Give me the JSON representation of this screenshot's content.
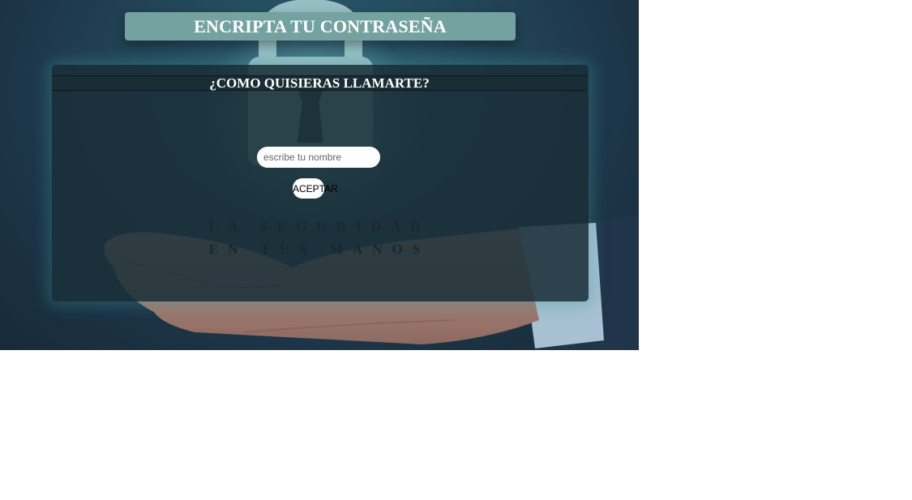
{
  "title": "ENCRIPTA TU CONTRASEÑA",
  "form": {
    "header": "¿COMO QUISIERAS LLAMARTE?",
    "name_placeholder": "escribe tu nombre",
    "name_value": "",
    "accept_label": "ACEPTAR"
  },
  "slogan": "LA SEGURIDAD EN TUS MANOS",
  "background": {
    "icons": [
      "padlock-icon",
      "hand-icon"
    ]
  },
  "colors": {
    "title_banner": "#74a2a0",
    "panel": "#1a3039",
    "glow": "#3c969b",
    "text": "#ffffff"
  }
}
